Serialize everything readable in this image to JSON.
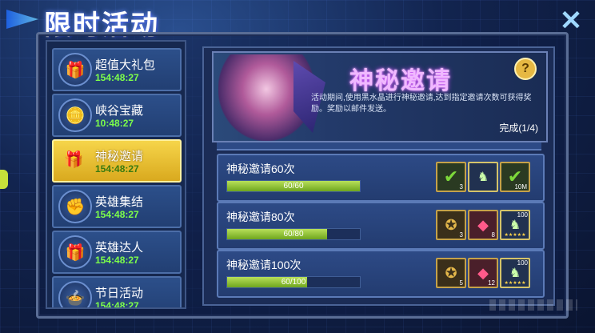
{
  "title": "限时活动",
  "close_symbol": "✕",
  "sidebar": {
    "items": [
      {
        "label": "超值大礼包",
        "timer": "154:48:27",
        "icon": "gift-box-icon",
        "glyph": "🎁",
        "active": false
      },
      {
        "label": "峡谷宝藏",
        "timer": "10:48:27",
        "icon": "treasure-icon",
        "glyph": "🪙",
        "active": false
      },
      {
        "label": "神秘邀请",
        "timer": "154:48:27",
        "icon": "gift-box-icon",
        "glyph": "🎁",
        "active": true
      },
      {
        "label": "英雄集结",
        "timer": "154:48:27",
        "icon": "gauntlet-icon",
        "glyph": "✊",
        "active": false
      },
      {
        "label": "英雄达人",
        "timer": "154:48:27",
        "icon": "blue-gift-icon",
        "glyph": "🎁",
        "active": false
      },
      {
        "label": "节日活动",
        "timer": "154:48:27",
        "icon": "food-icon",
        "glyph": "🍲",
        "active": false
      }
    ]
  },
  "banner": {
    "title": "神秘邀请",
    "help_symbol": "?",
    "description": "活动期间,使用黑水晶进行神秘邀请,达到指定邀请次数可获得奖励。奖励以邮件发送。",
    "progress": "完成(1/4)"
  },
  "tasks": [
    {
      "name": "神秘邀请60次",
      "progress_text": "60/60",
      "fraction": 1.0,
      "rewards": [
        {
          "type": "check",
          "count": "3"
        },
        {
          "type": "hero",
          "count": ""
        },
        {
          "type": "check",
          "count": "10M"
        }
      ]
    },
    {
      "name": "神秘邀请80次",
      "progress_text": "60/80",
      "fraction": 0.75,
      "rewards": [
        {
          "type": "gold",
          "count": "3"
        },
        {
          "type": "gem",
          "count": "8"
        },
        {
          "type": "hero",
          "count": "",
          "level": "100"
        }
      ]
    },
    {
      "name": "神秘邀请100次",
      "progress_text": "60/100",
      "fraction": 0.6,
      "rewards": [
        {
          "type": "gold",
          "count": "5"
        },
        {
          "type": "gem",
          "count": "12"
        },
        {
          "type": "hero",
          "count": "",
          "level": "100"
        }
      ]
    }
  ]
}
